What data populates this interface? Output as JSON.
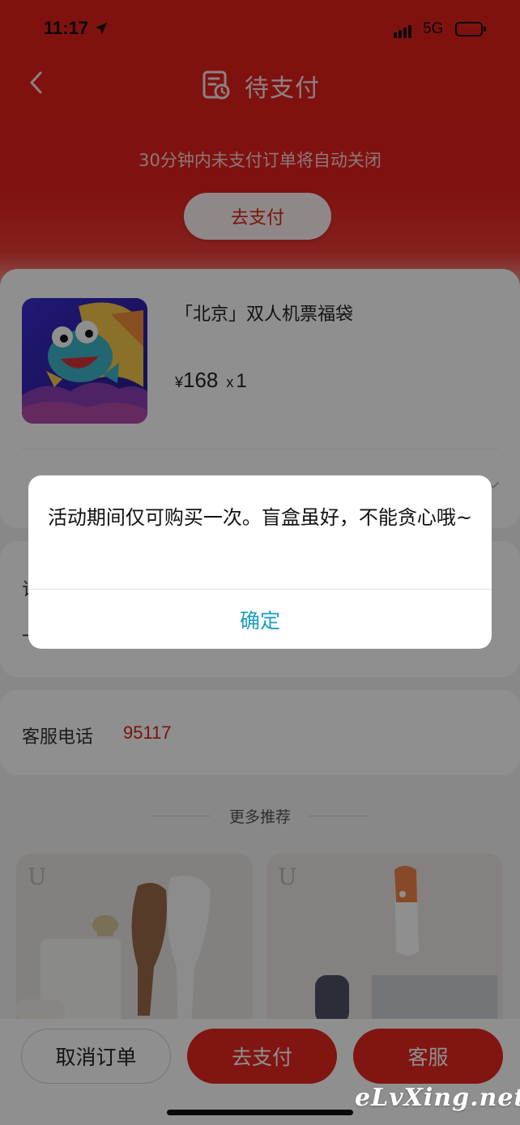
{
  "status_bar": {
    "time": "11:17",
    "network": "5G"
  },
  "header": {
    "title": "待支付",
    "notice": "30分钟内未支付订单将自动关闭",
    "pay_button": "去支付"
  },
  "product": {
    "name": "「北京」双人机票福袋",
    "currency": "¥",
    "price": "168",
    "qty_prefix": "x",
    "qty": "1"
  },
  "info": {
    "partial_line_1": "订",
    "partial_line_2": "一"
  },
  "service": {
    "label": "客服电话",
    "phone": "95117"
  },
  "recommend": {
    "title": "更多推荐",
    "brand_mark": "U"
  },
  "bottom_bar": {
    "cancel_label": "取消订单",
    "pay_label": "去支付",
    "service_label": "客服"
  },
  "dialog": {
    "message": "活动期间仅可购买一次。盲盒虽好，不能贪心哦~",
    "confirm_label": "确定"
  },
  "watermark": "eLvXing.net",
  "colors": {
    "brand_red": "#e4261f",
    "confirm_blue": "#1a9fc2"
  }
}
